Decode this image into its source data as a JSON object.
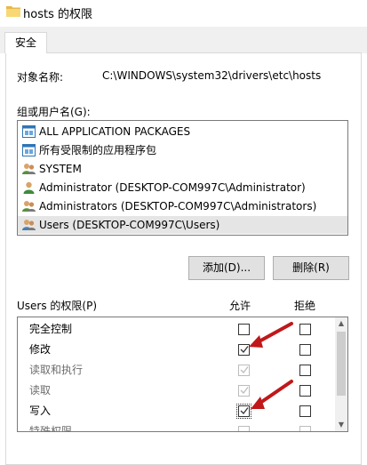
{
  "window": {
    "title": "hosts 的权限",
    "folder_icon": "folder-icon"
  },
  "tabs": [
    {
      "label": "安全"
    }
  ],
  "object": {
    "label": "对象名称:",
    "value": "C:\\WINDOWS\\system32\\drivers\\etc\\hosts"
  },
  "groups": {
    "label": "组或用户名(G):",
    "items": [
      {
        "name": "ALL APPLICATION PACKAGES",
        "icon": "package-group-icon"
      },
      {
        "name": "所有受限制的应用程序包",
        "icon": "package-group-icon"
      },
      {
        "name": "SYSTEM",
        "icon": "users-group-icon"
      },
      {
        "name": "Administrator (DESKTOP-COM997C\\Administrator)",
        "icon": "user-icon"
      },
      {
        "name": "Administrators (DESKTOP-COM997C\\Administrators)",
        "icon": "users-group-icon"
      },
      {
        "name": "Users (DESKTOP-COM997C\\Users)",
        "icon": "users-group-icon",
        "selected": true
      }
    ]
  },
  "buttons": {
    "add": "添加(D)...",
    "remove": "删除(R)"
  },
  "permissions": {
    "label": "Users 的权限(P)",
    "allow_header": "允许",
    "deny_header": "拒绝",
    "rows": [
      {
        "name": "完全控制",
        "allow": false,
        "deny": false,
        "allow_disabled": false
      },
      {
        "name": "修改",
        "allow": true,
        "deny": false,
        "allow_disabled": false
      },
      {
        "name": "读取和执行",
        "allow": true,
        "deny": false,
        "allow_disabled": true
      },
      {
        "name": "读取",
        "allow": true,
        "deny": false,
        "allow_disabled": true
      },
      {
        "name": "写入",
        "allow": true,
        "deny": false,
        "allow_disabled": false,
        "focused": true
      },
      {
        "name": "特殊权限",
        "allow": false,
        "deny": false,
        "allow_disabled": true
      }
    ]
  },
  "colors": {
    "annotation_arrow": "#c0181a",
    "selection": "#e5e5e5"
  }
}
